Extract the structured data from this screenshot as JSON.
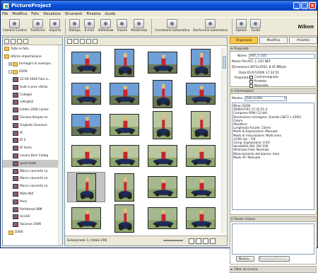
{
  "app": {
    "title": "PictureProject"
  },
  "menu": [
    "File",
    "Modifica",
    "Foto",
    "Visualizza",
    "Strumenti",
    "Finestra",
    "Guida"
  ],
  "toolbar": {
    "groups": [
      [
        "Camera Control",
        "Trasferisci",
        "Importa"
      ],
      [
        "Stampa",
        "E-mail",
        "Slideshow",
        "movee",
        "Masterizza"
      ],
      [
        "Correzione automatica",
        "Dochvrona automatico"
      ],
      [
        "Opzioni",
        "Guida"
      ]
    ],
    "logo": "Nikon"
  },
  "tree": [
    {
      "label": "Tutte le foto",
      "icon": "folder",
      "indent": 0
    },
    {
      "label": "Ultima importazione",
      "icon": "folder",
      "indent": 0
    },
    {
      "label": "Immagini di esempio",
      "icon": "folder",
      "indent": 1,
      "exp": "+"
    },
    {
      "label": "D200",
      "icon": "folder",
      "indent": 1,
      "exp": "-"
    },
    {
      "label": "22-09-2004 Foto a...",
      "icon": "thumb",
      "indent": 2
    },
    {
      "label": "Auto e prov vibraz",
      "icon": "thumb",
      "indent": 2
    },
    {
      "label": "Colleghi",
      "icon": "thumb",
      "indent": 2
    },
    {
      "label": "colleghi2",
      "icon": "thumb",
      "indent": 2
    },
    {
      "label": "Estate 2006 Lantel",
      "icon": "thumb",
      "indent": 2
    },
    {
      "label": "Genova Knopes to",
      "icon": "thumb",
      "indent": 2
    },
    {
      "label": "Grigliata Giovanni",
      "icon": "thumb",
      "indent": 2
    },
    {
      "label": "IR",
      "icon": "thumb",
      "indent": 2
    },
    {
      "label": "IR 2",
      "icon": "thumb",
      "indent": 2
    },
    {
      "label": "IR Astro",
      "icon": "thumb",
      "indent": 2
    },
    {
      "label": "Lavoro Boni Colleg",
      "icon": "thumb",
      "indent": 2
    },
    {
      "label": "Lycia moto",
      "icon": "thumb",
      "indent": 2,
      "selected": true
    },
    {
      "label": "Marco concerto ca",
      "icon": "thumb",
      "indent": 2
    },
    {
      "label": "Marco concerto ca",
      "icon": "thumb",
      "indent": 2
    },
    {
      "label": "Marco concerto ca",
      "icon": "thumb",
      "indent": 2
    },
    {
      "label": "Moto Nef",
      "icon": "thumb",
      "indent": 2
    },
    {
      "label": "Peck",
      "icon": "thumb",
      "indent": 2
    },
    {
      "label": "Portatmail IBM",
      "icon": "thumb",
      "indent": 2
    },
    {
      "label": "Uccelli",
      "icon": "thumb",
      "indent": 2
    },
    {
      "label": "Vacanze 2006",
      "icon": "thumb",
      "indent": 2
    },
    {
      "label": "D300",
      "icon": "folder",
      "indent": 1
    }
  ],
  "thumbnails": {
    "count": 24,
    "selected_index": 16
  },
  "status": {
    "text": "Selezionate 1, totale 206"
  },
  "rightpane": {
    "tabs": [
      "Organizza",
      "Modifica",
      "Proietta"
    ],
    "active_tab": "Organizza",
    "properties": {
      "header": "Proprietà",
      "name_label": "Nome:",
      "name_value": "AST_1 (32)",
      "file_name": "Nome file:AST_1 (32).NEF",
      "dimensions": "Dimensioni:3872x2592, 8.45 MByte",
      "date": "Data:01/07/2006 17:32:51",
      "props_label": "Proprietà:",
      "checkboxes": [
        "Contrassegnata",
        "Protetta",
        "Nascosta"
      ]
    },
    "info": {
      "header": "Informazioni",
      "show_label": "Mostra:",
      "show_value": "Dati scatto",
      "lines": [
        "Nikon D200",
        "2006/07/01 17:32:51.4",
        "Compress RAW (12-bit)",
        "Dimensione immagine: Grande (3872 x 2592)",
        "Colore",
        "Obiettivo:",
        "Lunghezza Focale: 15mm",
        "Modo di Esposizione: Manuale",
        "Modo di misurazione: Multi-zona",
        "1/200 sec - F/8",
        "Comp. Esposizione: 0 EV",
        "Sensibilità ISO: ISO 100",
        "Ottimizza Foto: Normale",
        "Bilanciamento del bianco: Auto",
        "Modo AF: Manuale"
      ]
    },
    "keywords": {
      "header": "Parole chiave",
      "new_button": "Nuova...",
      "rename_button": "Rinomina/Elimina..."
    },
    "filter": {
      "header": "Filtro di ricerca"
    }
  }
}
